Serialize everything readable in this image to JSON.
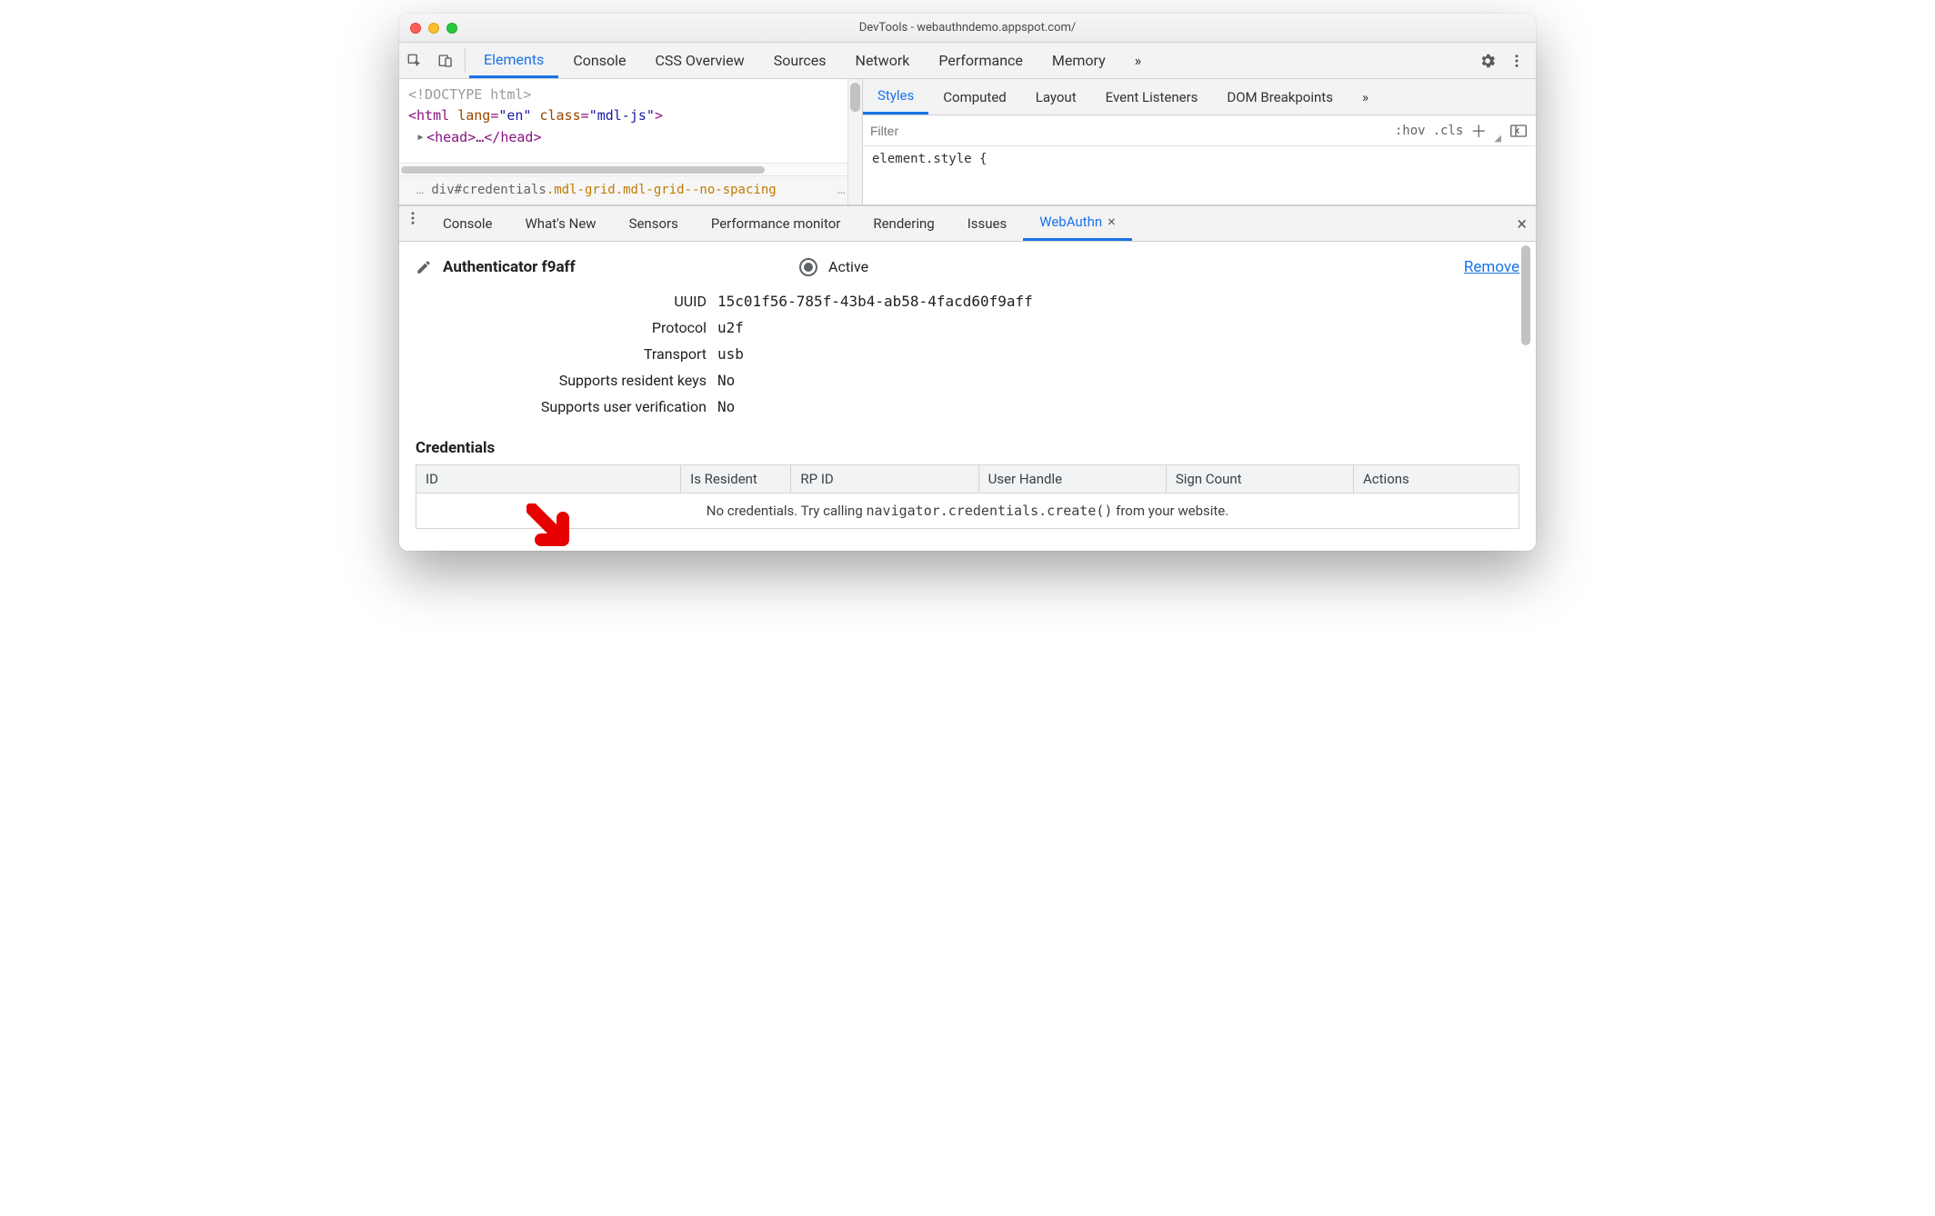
{
  "window": {
    "title": "DevTools - webauthndemo.appspot.com/"
  },
  "toolbar": {
    "tabs": [
      "Elements",
      "Console",
      "CSS Overview",
      "Sources",
      "Network",
      "Performance",
      "Memory"
    ],
    "active": "Elements",
    "overflow": "»"
  },
  "dom": {
    "doctype": "<!DOCTYPE html>",
    "html_open_prefix": "<html ",
    "html_lang_attr": "lang",
    "html_lang_val": "\"en\"",
    "html_class_attr": "class",
    "html_class_val": "\"mdl-js\"",
    "html_open_suffix": ">",
    "head": "<head>…</head>"
  },
  "breadcrumbs": {
    "dots_left": "…",
    "el": "div",
    "id": "#credentials",
    "classes": ".mdl-grid.mdl-grid--no-spacing",
    "dots_right": "…"
  },
  "styles": {
    "tabs": [
      "Styles",
      "Computed",
      "Layout",
      "Event Listeners",
      "DOM Breakpoints"
    ],
    "active": "Styles",
    "overflow": "»",
    "filter_placeholder": "Filter",
    "hov": ":hov",
    "cls": ".cls",
    "element_style": "element.style {"
  },
  "drawer": {
    "tabs": [
      "Console",
      "What's New",
      "Sensors",
      "Performance monitor",
      "Rendering",
      "Issues",
      "WebAuthn"
    ],
    "active": "WebAuthn"
  },
  "webauthn": {
    "name": "Authenticator f9aff",
    "active_label": "Active",
    "remove": "Remove",
    "rows": {
      "uuid_k": "UUID",
      "uuid_v": "15c01f56-785f-43b4-ab58-4facd60f9aff",
      "proto_k": "Protocol",
      "proto_v": "u2f",
      "trans_k": "Transport",
      "trans_v": "usb",
      "resident_k": "Supports resident keys",
      "resident_v": "No",
      "uv_k": "Supports user verification",
      "uv_v": "No"
    },
    "credentials_header": "Credentials",
    "columns": [
      "ID",
      "Is Resident",
      "RP ID",
      "User Handle",
      "Sign Count",
      "Actions"
    ],
    "empty_prefix": "No credentials. Try calling ",
    "empty_code": "navigator.credentials.create()",
    "empty_suffix": " from your website."
  }
}
